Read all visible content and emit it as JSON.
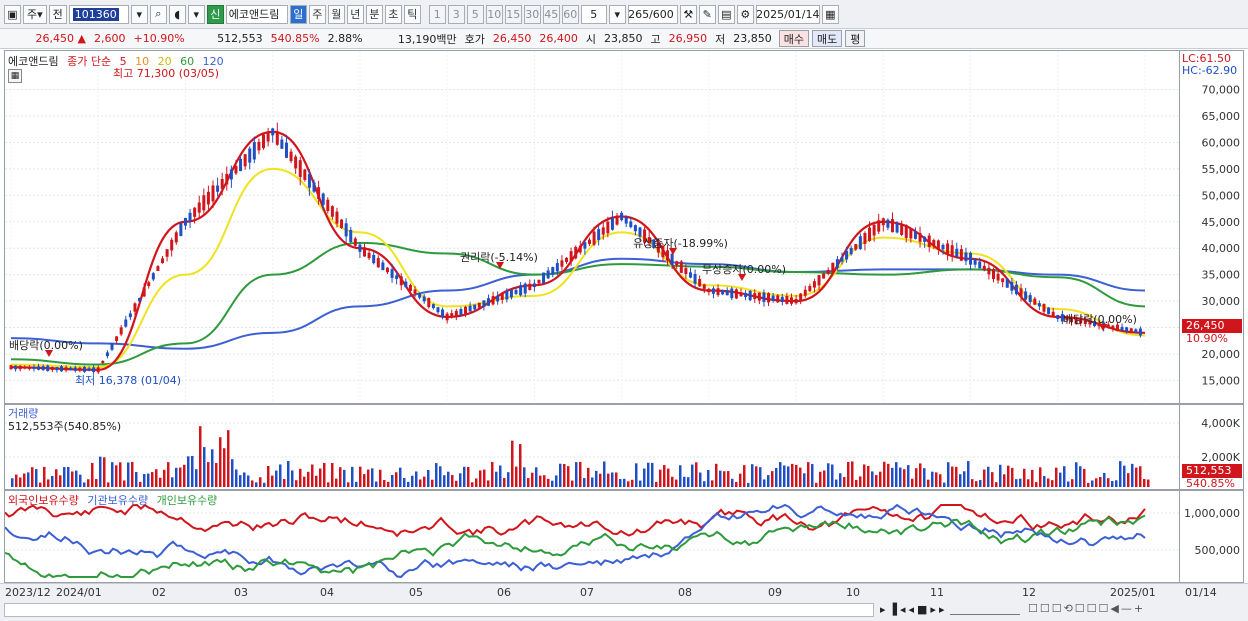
{
  "toolbar": {
    "period_type": "주",
    "prev_label": "전",
    "code": "101360",
    "badge": "신",
    "stock_name": "에코앤드림",
    "periods": [
      "일",
      "주",
      "월",
      "년",
      "분",
      "초",
      "틱"
    ],
    "active_period": "일",
    "intervals": [
      "1",
      "3",
      "5",
      "10",
      "15",
      "30",
      "45",
      "60"
    ],
    "interval_value": "5",
    "count": "265/600",
    "date": "2025/01/14"
  },
  "quote": {
    "price": "26,450",
    "change": "2,600",
    "change_pct": "+10.90%",
    "volume": "512,553",
    "volume_ratio": "540.85%",
    "turnover_pct": "2.88%",
    "amount": "13,190백만",
    "hoga_label": "호가",
    "ask": "26,450",
    "bid": "26,400",
    "open_label": "시",
    "open": "23,850",
    "high_label": "고",
    "high": "26,950",
    "low_label": "저",
    "low": "23,850",
    "buy_label": "매수",
    "sell_label": "매도",
    "eval_label": "평"
  },
  "price_panel": {
    "name": "에코앤드림",
    "ma_title": "종가 단순",
    "ma_periods": [
      "5",
      "10",
      "20",
      "60",
      "120"
    ],
    "max_label": "최고 71,300 (03/05)",
    "min_label": "최저 16,378 (01/04)",
    "lc": "LC:61.50",
    "hc": "HC:-62.90",
    "current_tag": "26,450",
    "current_pct": "10.90%",
    "events": [
      "배당락(0.00%)",
      "권리락(-5.14%)",
      "무상증자(0.00%)",
      "유상증자(-18.99%)",
      "무상증자(0.00%)",
      "배당락(0.00%)"
    ],
    "y_ticks": [
      "15,000",
      "20,000",
      "25,000",
      "30,000",
      "35,000",
      "40,000",
      "45,000",
      "50,000",
      "55,000",
      "60,000",
      "65,000",
      "70,000"
    ]
  },
  "volume_panel": {
    "title": "거래량",
    "value": "512,553주(540.85%)",
    "tag": "512,553",
    "tag_pct": "540.85%",
    "y_ticks": [
      "2,000K",
      "4,000K"
    ]
  },
  "holding_panel": {
    "series": [
      "외국인보유수량",
      "기관보유수량",
      "개인보유수량"
    ],
    "y_ticks": [
      "500,000",
      "1,000,000"
    ]
  },
  "x_axis": {
    "labels": [
      "2023/12",
      "2024/01",
      "02",
      "03",
      "04",
      "05",
      "06",
      "07",
      "08",
      "09",
      "10",
      "11",
      "12",
      "2025/01",
      "01/14"
    ]
  },
  "colors": {
    "up": "#d0161c",
    "down": "#1f4fc4",
    "ma5": "#d0161c",
    "ma10": "#f08a1c",
    "ma20": "#f0e21c",
    "ma60": "#2e9a3c",
    "ma120": "#3c5fd4"
  },
  "chart_data": {
    "type": "line",
    "title": "",
    "x": [
      "2023/12",
      "2024/01",
      "02",
      "03",
      "04",
      "05",
      "06",
      "07",
      "08",
      "09",
      "10",
      "11",
      "12",
      "2025/01"
    ],
    "series": [
      {
        "name": "종가",
        "values": [
          17500,
          17000,
          45000,
          62000,
          40000,
          27000,
          33000,
          46000,
          32000,
          30000,
          45000,
          38000,
          27000,
          24000
        ]
      },
      {
        "name": "20",
        "values": [
          18000,
          17500,
          35000,
          55000,
          43000,
          29000,
          31000,
          43000,
          33000,
          31000,
          42000,
          39000,
          28500,
          23500
        ]
      },
      {
        "name": "60",
        "values": [
          19000,
          18000,
          22000,
          35000,
          41000,
          39000,
          35000,
          37000,
          36500,
          35500,
          35000,
          36000,
          34500,
          29000
        ]
      },
      {
        "name": "120",
        "values": [
          23000,
          22000,
          21000,
          24000,
          29000,
          32000,
          35000,
          38000,
          37000,
          35500,
          36000,
          36000,
          35000,
          32000
        ]
      }
    ],
    "ylim": [
      13000,
      72000
    ]
  }
}
